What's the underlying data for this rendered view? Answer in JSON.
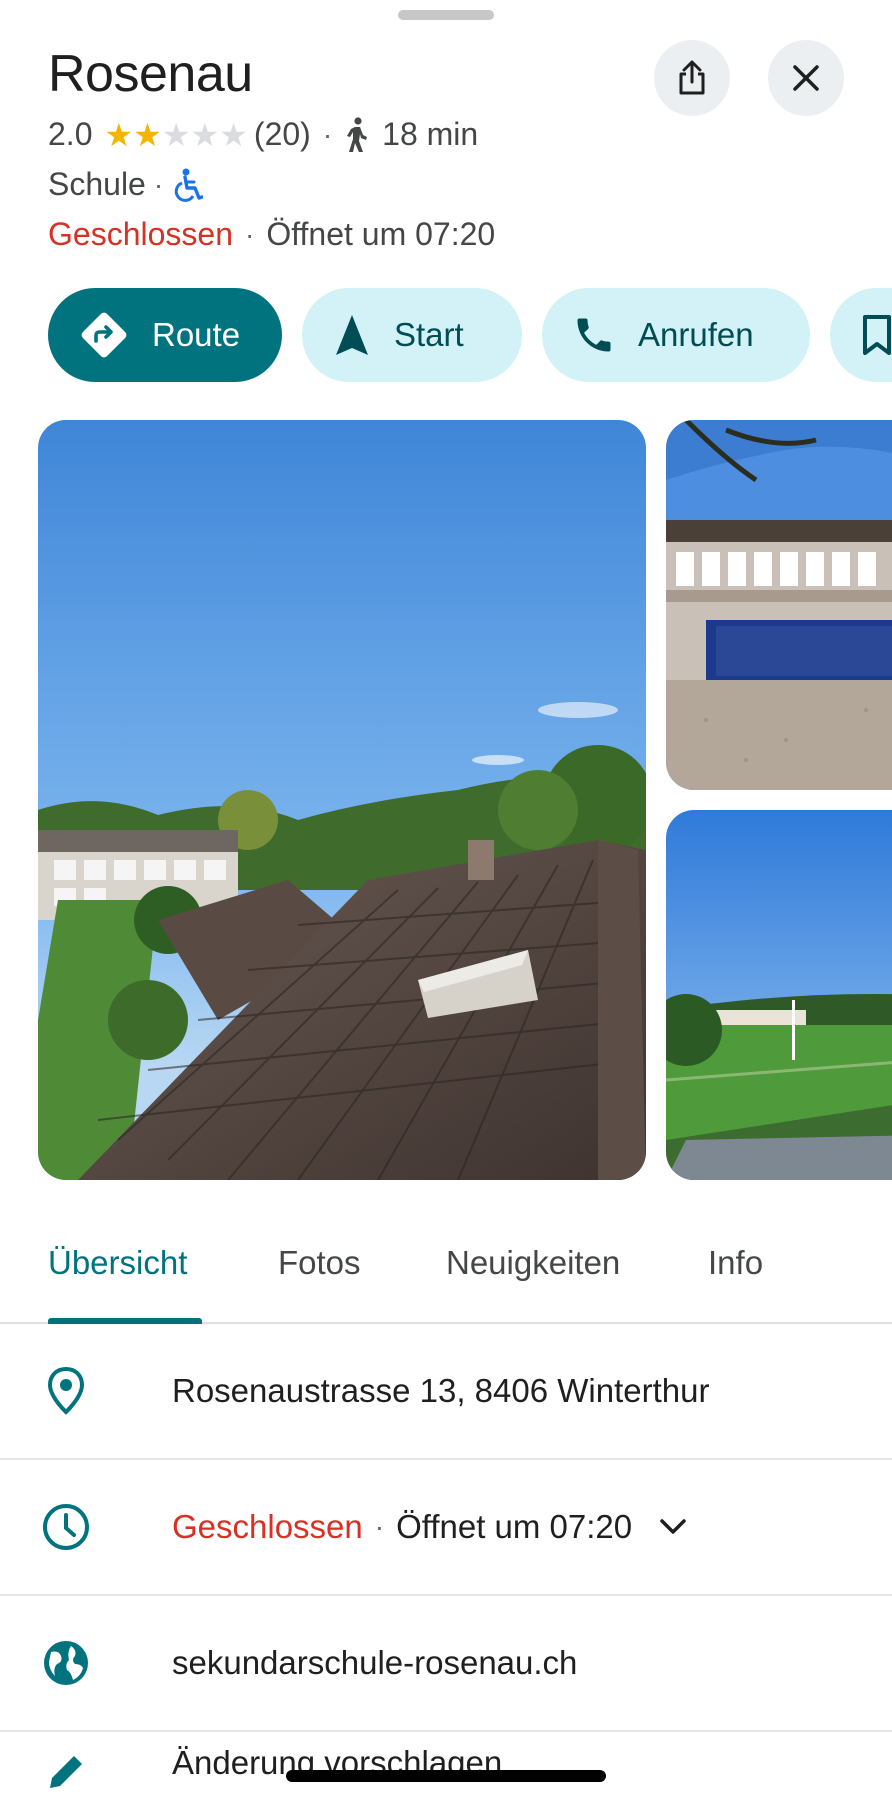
{
  "place": {
    "name": "Rosenau",
    "rating": "2.0",
    "rating_stars": 2,
    "rating_max": 5,
    "review_count": "(20)",
    "walk_time": "18 min",
    "category": "Schule",
    "status": "Geschlossen",
    "opens": "Öffnet um 07:20"
  },
  "actions": {
    "route": "Route",
    "start": "Start",
    "call": "Anrufen"
  },
  "tabs": [
    "Übersicht",
    "Fotos",
    "Neuigkeiten",
    "Info"
  ],
  "active_tab": "Übersicht",
  "info": {
    "address": "Rosenaustrasse 13, 8406 Winterthur",
    "hours_status": "Geschlossen",
    "hours_opens": "Öffnet um 07:20",
    "website": "sekundarschule-rosenau.ch",
    "suggest_edit": "Änderung vorschlagen"
  },
  "icons": {
    "share": "share-icon",
    "close": "close-icon",
    "walk": "walking-person-icon",
    "accessible": "wheelchair-icon",
    "route": "directions-icon",
    "start": "navigation-arrow-icon",
    "call": "phone-icon",
    "save": "bookmark-icon",
    "address": "location-pin-icon",
    "hours": "clock-icon",
    "expand": "chevron-down-icon",
    "website": "globe-icon",
    "edit": "pencil-icon"
  },
  "colors": {
    "accent": "#00737f",
    "accent_light": "#d2f2f7",
    "closed_red": "#d93025",
    "star": "#f4b400",
    "accessible_blue": "#1a73e8"
  }
}
